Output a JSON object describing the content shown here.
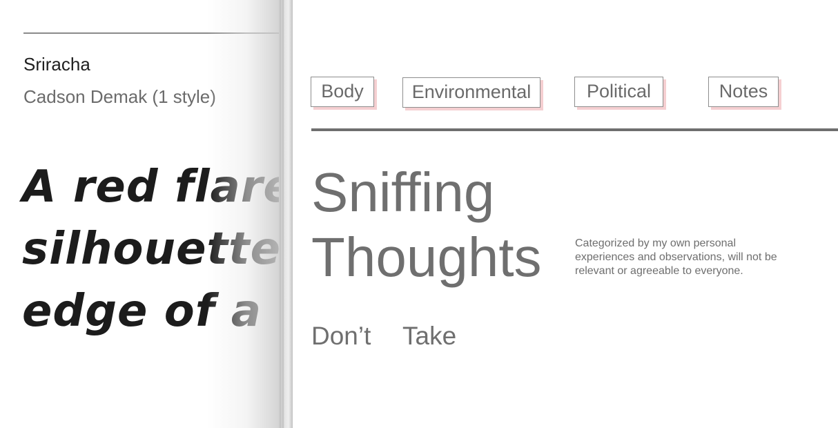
{
  "font_preview": {
    "font_name": "Sriracha",
    "font_meta": "Cadson Demak (1 style)",
    "sample_lines": [
      "A red flare",
      "silhouetted",
      "edge of a w"
    ]
  },
  "article": {
    "tags": [
      "Body",
      "Environmental",
      "Political",
      "Notes"
    ],
    "title_lines": [
      "Sniffing",
      "Thoughts"
    ],
    "description": "Categorized by my own personal experiences and observations, will not be relevant or agreeable to everyone.",
    "words": [
      "Don’t",
      "Take"
    ]
  },
  "colors": {
    "tag_shadow": "#f5cfd1",
    "title_text": "#6f6f6f",
    "font_name_text": "#202020",
    "font_meta_text": "#6b6b6b"
  }
}
